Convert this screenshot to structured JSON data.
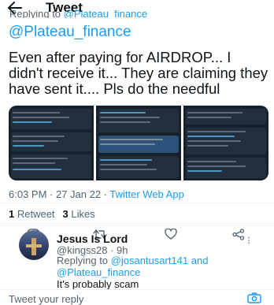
{
  "header": {
    "title": "Tweet",
    "back_icon": "back-arrow-icon"
  },
  "tweet": {
    "replying_prefix": "Replying to ",
    "replying_mention": "@Plateau_finance",
    "mention_line": "@Plateau_finance",
    "text": "Even after paying for AIRDROP... I didn't receive it... They are claiming they have sent it.... Pls do the needful",
    "timestamp": "6:03 PM · 27 Jan 22 · ",
    "client": "Twitter Web App",
    "retweets_count": "1",
    "retweets_label": " Retweet",
    "likes_count": "3",
    "likes_label": " Likes"
  },
  "actions": {
    "reply_icon": "reply-icon",
    "retweet_icon": "retweet-icon",
    "like_icon": "heart-icon",
    "share_icon": "share-icon"
  },
  "reply": {
    "name": "Jesus Is Lord",
    "handle_time": "@kingss28 · 9h",
    "replying_prefix": "Replying to ",
    "replying_mentions": "@josantusart141 and @Plateau_finance",
    "text": "It's probably scam"
  },
  "compose": {
    "placeholder": "Tweet your reply"
  },
  "colors": {
    "accent": "#1d9bf0",
    "text": "#0f1419",
    "muted": "#536471"
  }
}
